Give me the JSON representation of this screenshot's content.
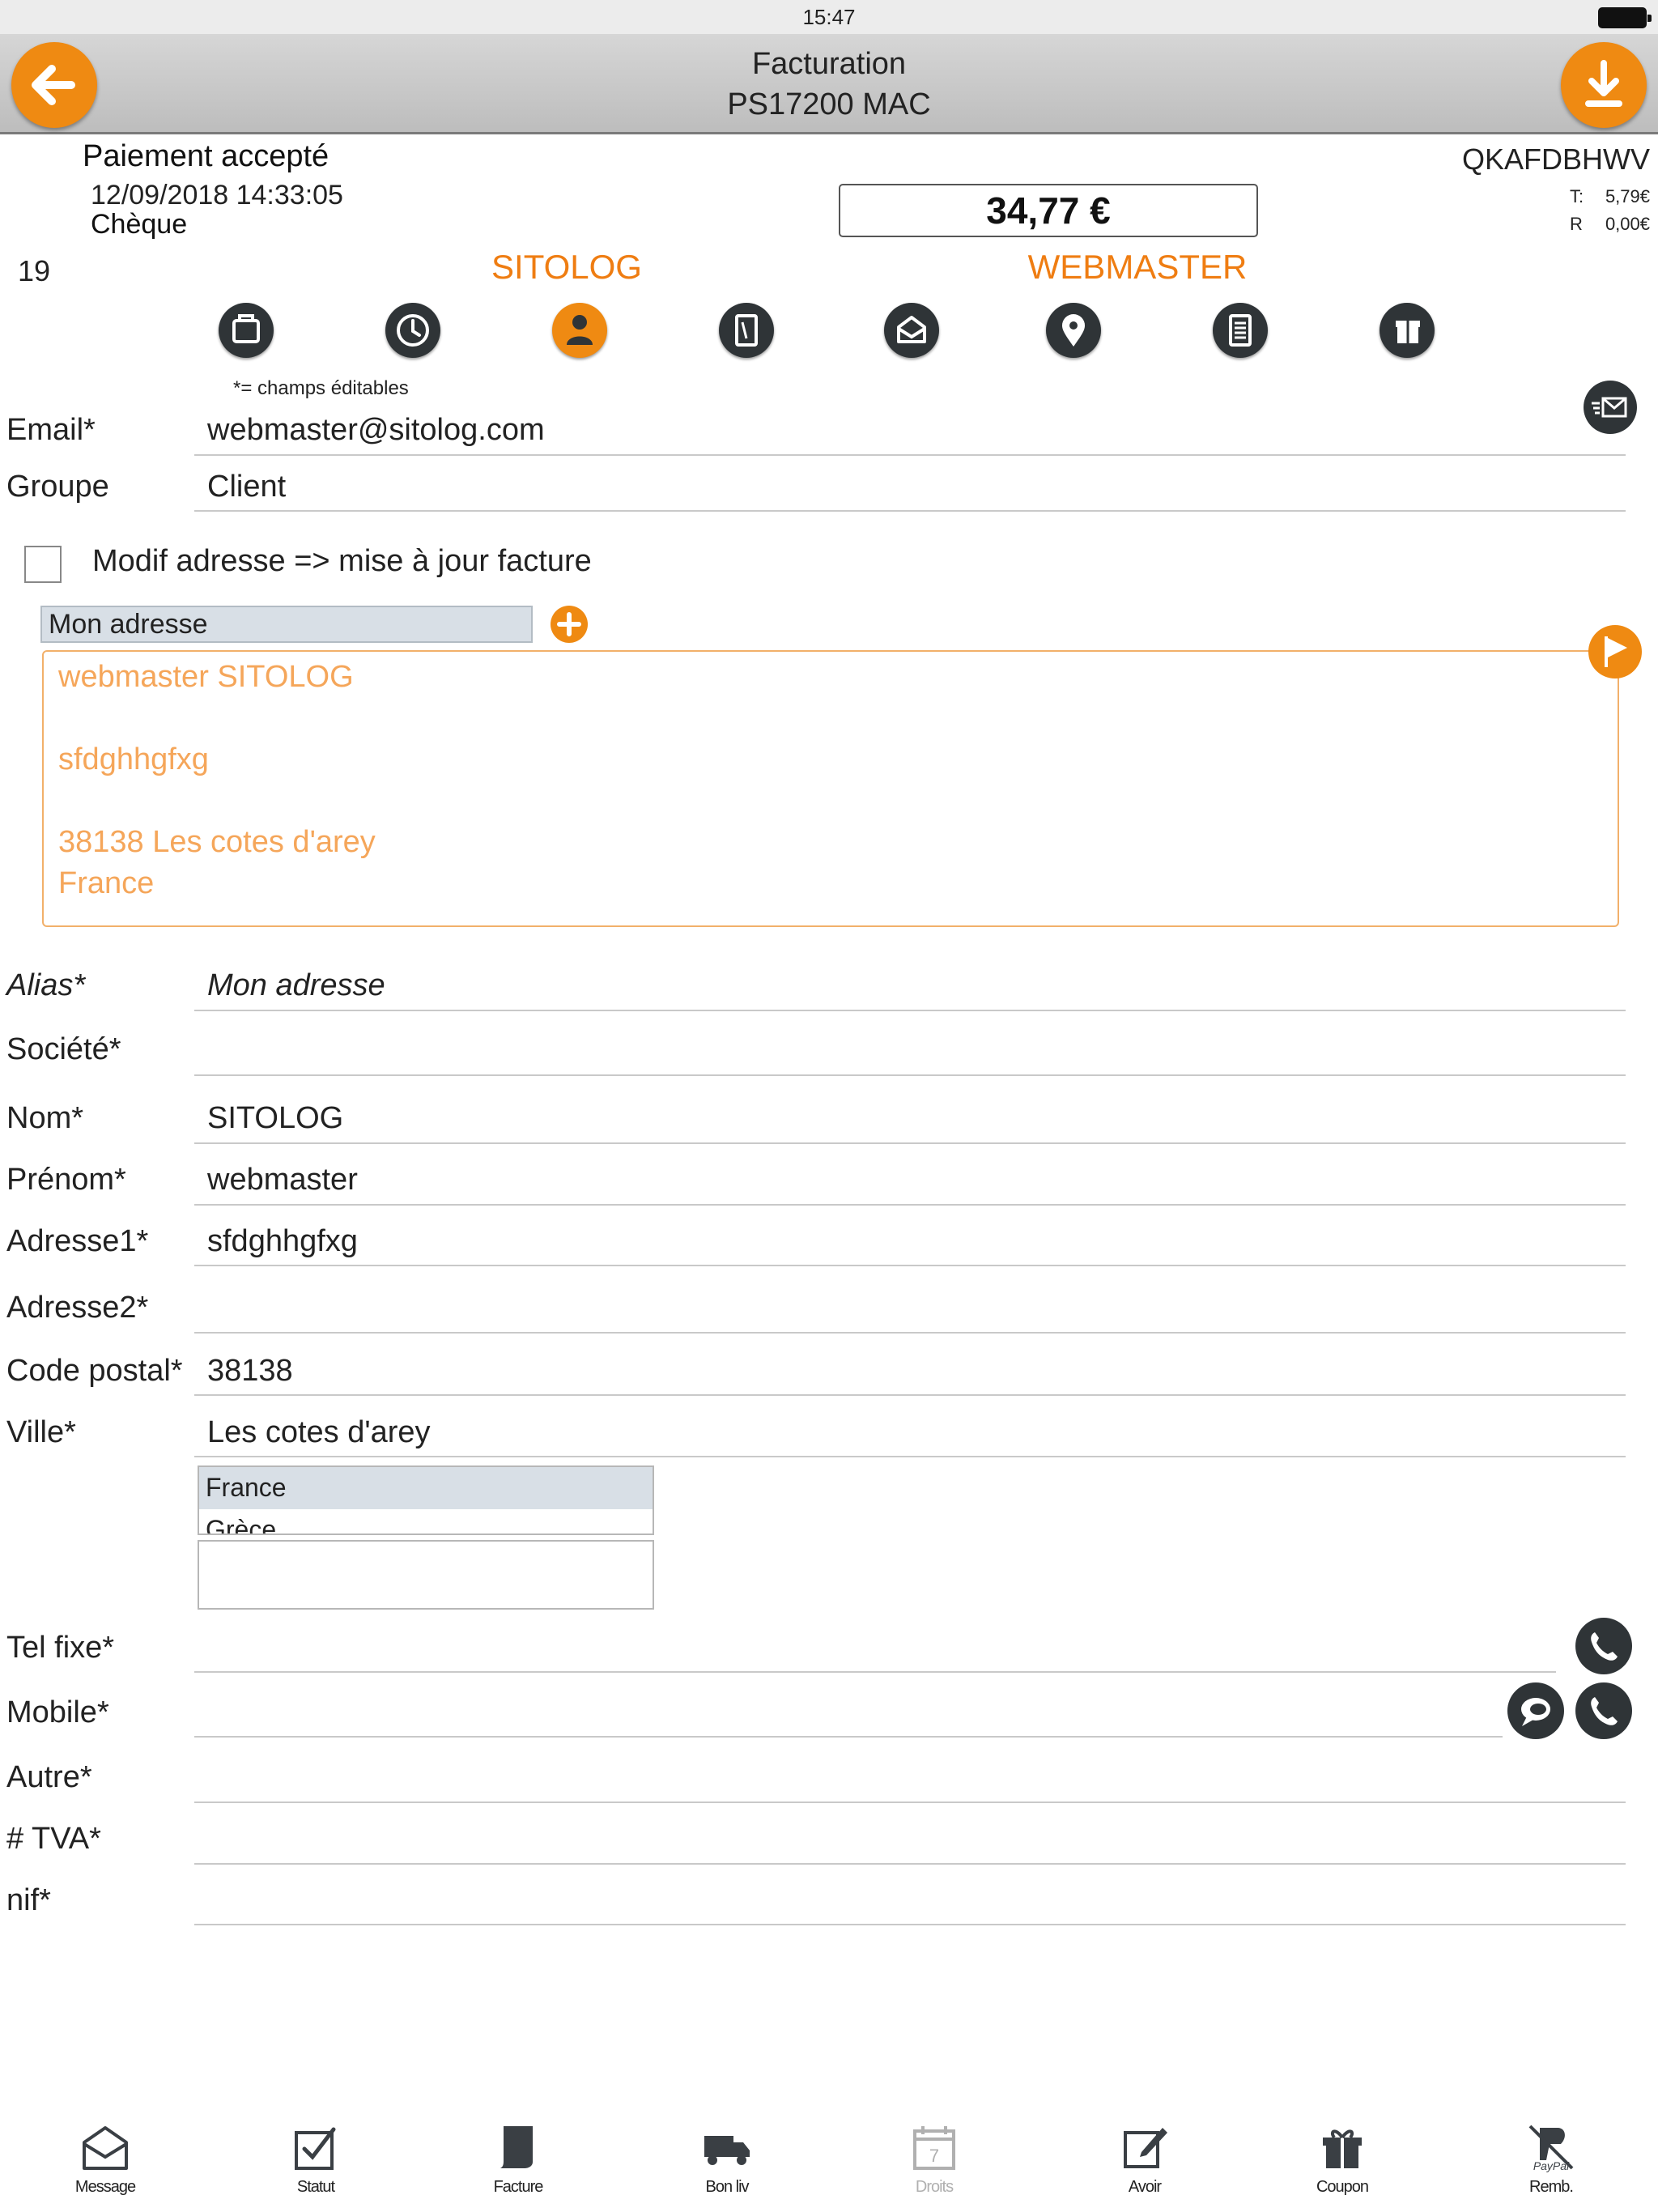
{
  "status_bar": {
    "time": "15:47"
  },
  "nav": {
    "title": "Facturation",
    "subtitle": "PS17200 MAC",
    "back_icon": "arrow-left-icon",
    "download_icon": "download-icon"
  },
  "order": {
    "status": "Paiement accepté",
    "date": "12/09/2018 14:33:05",
    "payment_method": "Chèque",
    "reference": "QKAFDBHWV",
    "total": "34,77 €",
    "tax_label": "T:",
    "tax_value": "5,79€",
    "discount_label": "R",
    "discount_value": "0,00€"
  },
  "customer": {
    "id": "19",
    "lastname": "SITOLOG",
    "firstname": "WEBMASTER"
  },
  "toolbar": {
    "icons": [
      "cart-icon",
      "history-icon",
      "customer-icon",
      "document-icon",
      "message-icon",
      "location-icon",
      "list-icon",
      "gift-icon"
    ],
    "active_index": 2,
    "editable_note": "*= champs éditables"
  },
  "form": {
    "email_label": "Email*",
    "email_value": "webmaster@sitolog.com",
    "group_label": "Groupe",
    "group_value": "Client",
    "modif_label": "Modif adresse => mise à jour facture",
    "modif_checked": false,
    "address_select": "Mon adresse",
    "address_preview": {
      "line1": "webmaster SITOLOG",
      "line2": "sfdghhgfxg",
      "line3": "38138 Les cotes d'arey",
      "line4": "France"
    },
    "alias_label": "Alias*",
    "alias_value": "Mon adresse",
    "company_label": "Société*",
    "company_value": "",
    "lastname_label": "Nom*",
    "lastname_value": "SITOLOG",
    "firstname_label": "Prénom*",
    "firstname_value": "webmaster",
    "address1_label": "Adresse1*",
    "address1_value": "sfdghhgfxg",
    "address2_label": "Adresse2*",
    "address2_value": "",
    "postcode_label": "Code postal*",
    "postcode_value": "38138",
    "city_label": "Ville*",
    "city_value": "Les cotes d'arey",
    "country_options": [
      "France",
      "Grèce"
    ],
    "country_selected": "France",
    "phone_label": "Tel fixe*",
    "mobile_label": "Mobile*",
    "other_label": "Autre*",
    "vat_label": "# TVA*",
    "nif_label": "nif*"
  },
  "tabbar": {
    "message": "Message",
    "status": "Statut",
    "invoice": "Facture",
    "delivery": "Bon liv",
    "rights": "Droits",
    "credit": "Avoir",
    "coupon": "Coupon",
    "refund": "Remb.",
    "refund_brand": "PayPal"
  },
  "colors": {
    "accent": "#ef8a12",
    "icon_dark": "#2f3437",
    "address_text": "#f5a65a"
  }
}
